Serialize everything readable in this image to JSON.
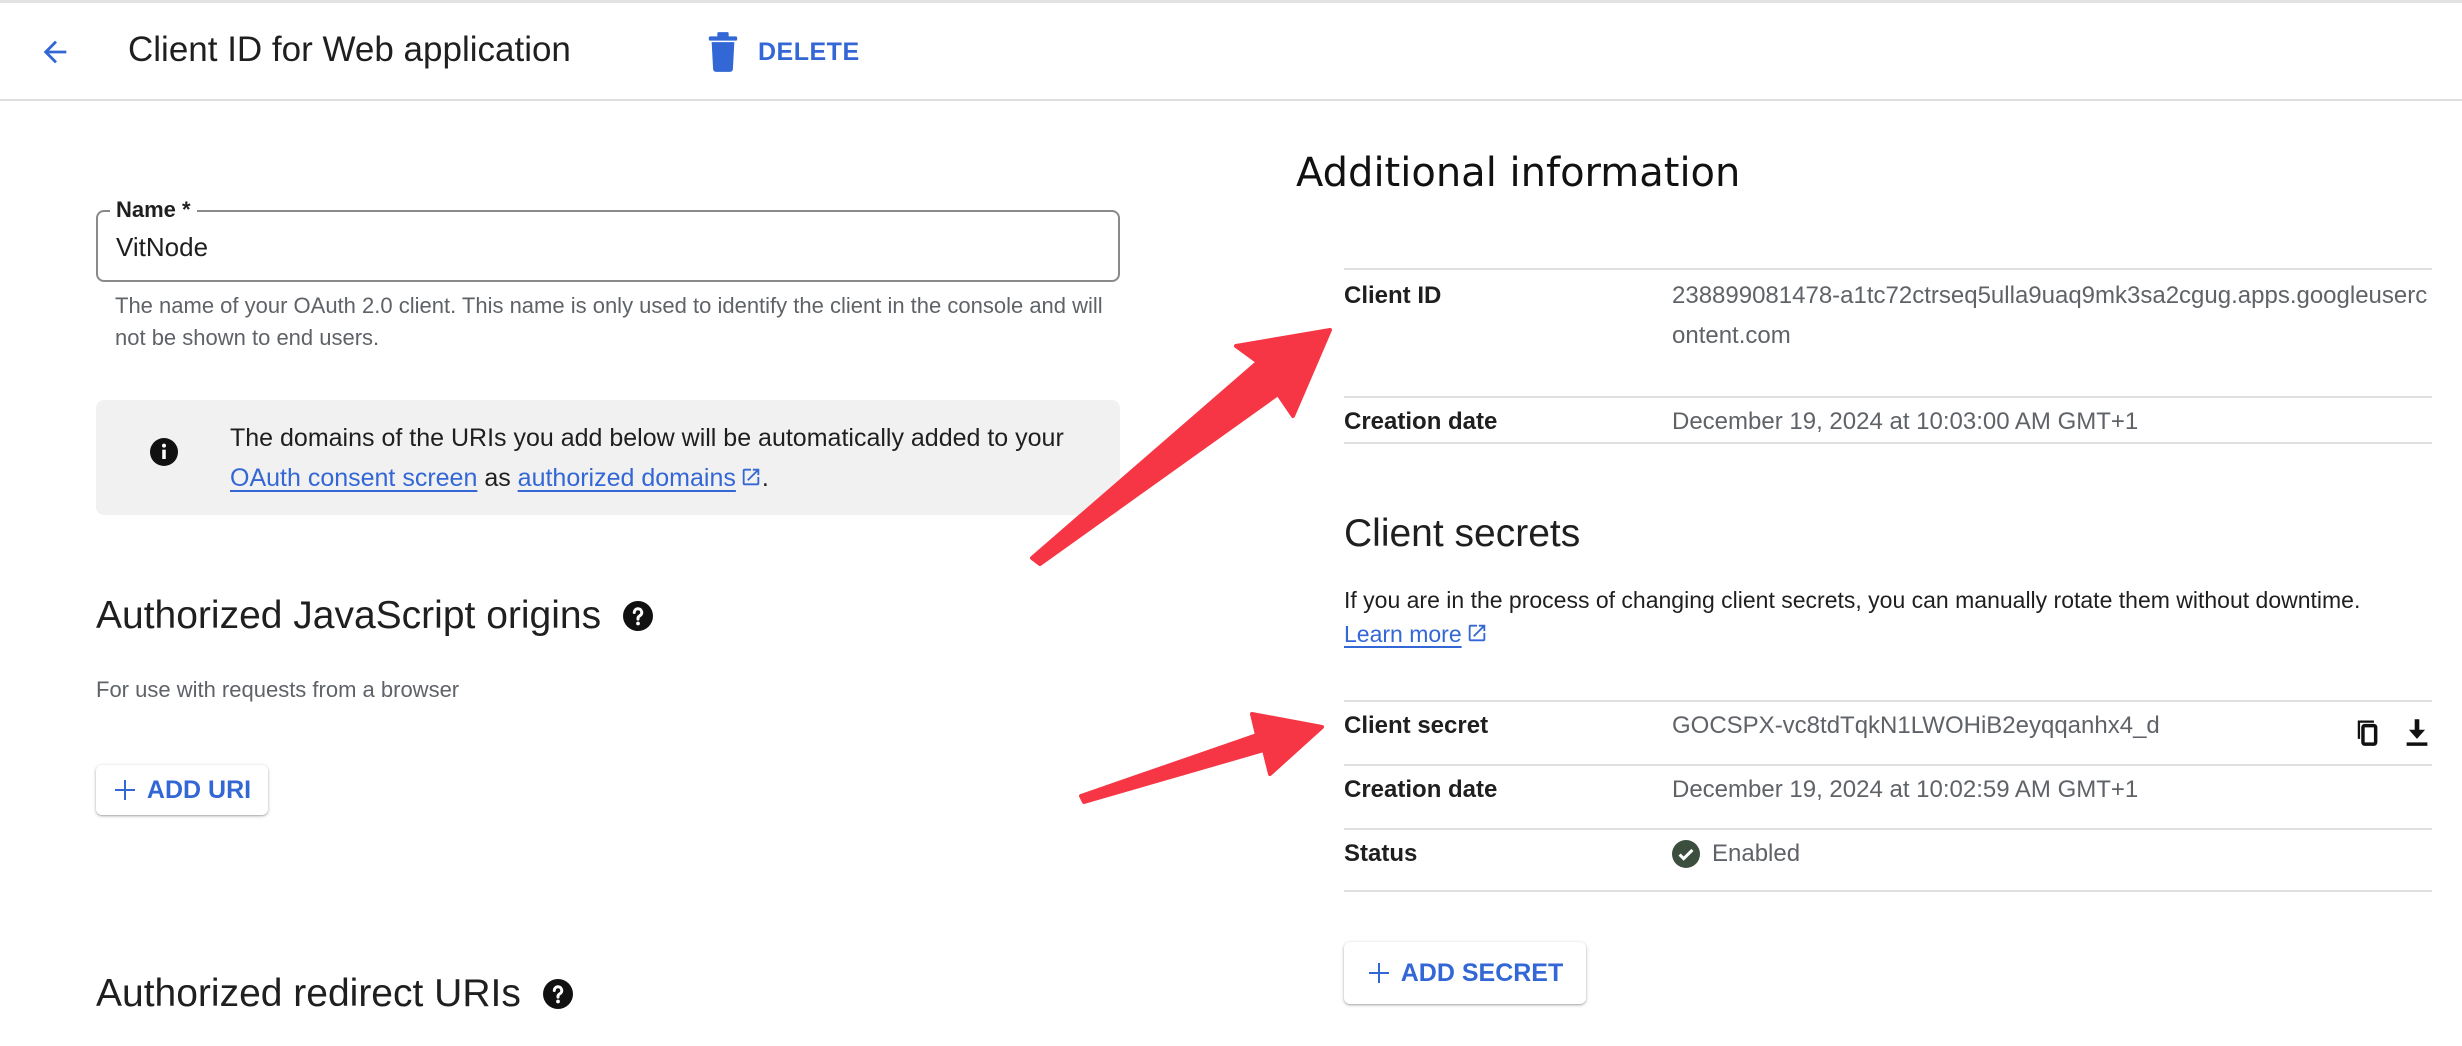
{
  "header": {
    "back_label": "Back",
    "title": "Client ID for Web application",
    "delete_label": "DELETE"
  },
  "name_field": {
    "label": "Name *",
    "value": "VitNode",
    "help": "The name of your OAuth 2.0 client. This name is only used to identify the client in the console and will not be shown to end users."
  },
  "info_box": {
    "text_before": "The domains of the URIs you add below will be automatically added to your ",
    "link1": "OAuth consent screen",
    "text_middle": " as ",
    "link2": "authorized domains",
    "text_after": "."
  },
  "js_origins": {
    "title": "Authorized JavaScript origins",
    "subtitle": "For use with requests from a browser",
    "add_label": "ADD URI"
  },
  "redirect_uris": {
    "title": "Authorized redirect URIs"
  },
  "additional_info": {
    "title": "Additional information",
    "rows": [
      {
        "key": "Client ID",
        "value": "238899081478-a1tc72ctrseq5ulla9uaq9mk3sa2cgug.apps.googleusercontent.com"
      },
      {
        "key": "Creation date",
        "value": "December 19, 2024 at 10:03:00 AM GMT+1"
      }
    ]
  },
  "client_secrets": {
    "title": "Client secrets",
    "description": "If you are in the process of changing client secrets, you can manually rotate them without downtime.",
    "learn_more": "Learn more",
    "rows": [
      {
        "key": "Client secret",
        "value": "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"
      },
      {
        "key": "Creation date",
        "value": "December 19, 2024 at 10:02:59 AM GMT+1"
      },
      {
        "key": "Status",
        "value": "Enabled"
      }
    ],
    "add_label": "ADD SECRET"
  },
  "colors": {
    "accent": "#3367d6",
    "annotation_arrow": "#f63645",
    "status_enabled": "#3c4f3f"
  }
}
